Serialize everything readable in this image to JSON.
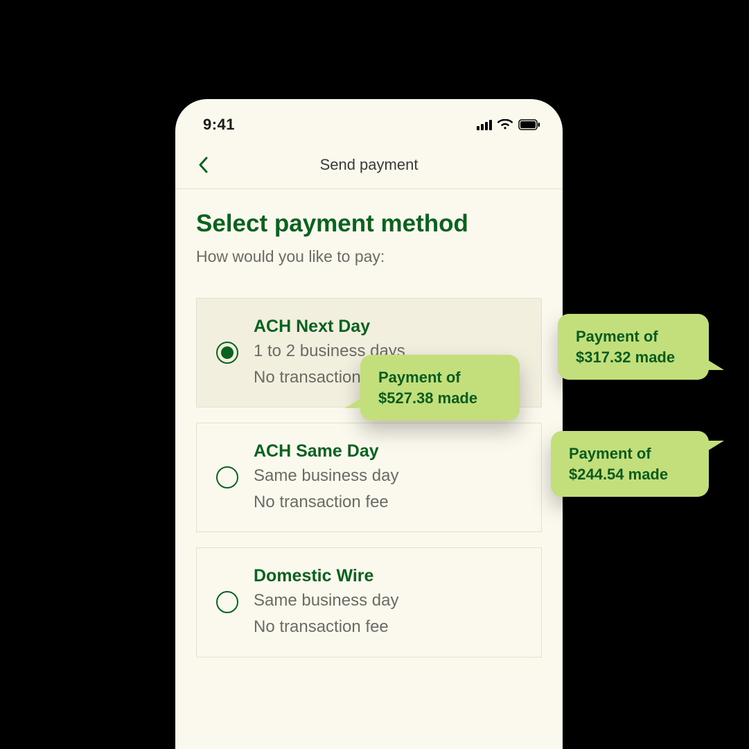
{
  "statusbar": {
    "time": "9:41"
  },
  "nav": {
    "title": "Send payment"
  },
  "page": {
    "heading": "Select payment method",
    "subtitle": "How would you like to pay:"
  },
  "options": [
    {
      "title": "ACH Next Day",
      "line1": "1 to 2 business days",
      "line2": "No transaction fee",
      "selected": true
    },
    {
      "title": "ACH Same Day",
      "line1": "Same business day",
      "line2": "No transaction fee",
      "selected": false
    },
    {
      "title": "Domestic Wire",
      "line1": "Same business day",
      "line2": "No transaction fee",
      "selected": false
    }
  ],
  "bubbles": [
    {
      "line1": "Payment of",
      "line2": "$527.38 made"
    },
    {
      "line1": "Payment of",
      "line2": "$317.32 made"
    },
    {
      "line1": "Payment of",
      "line2": "$244.54 made"
    }
  ]
}
